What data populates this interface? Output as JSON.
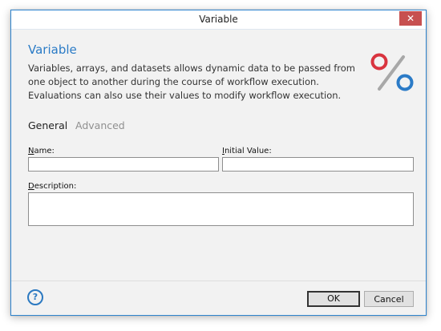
{
  "window": {
    "title": "Variable",
    "close_glyph": "✕"
  },
  "header": {
    "title": "Variable",
    "description": "Variables, arrays, and datasets allows dynamic data to be passed from one object to another during the course of workflow execution. Evaluations can also use their values to modify workflow execution.",
    "logo_icon": "percent-icon",
    "logo_colors": {
      "top_circle": "#d9343f",
      "bottom_circle": "#2b7bc7",
      "slash": "#a8a8a8"
    }
  },
  "tabs": [
    {
      "label": "General",
      "active": true
    },
    {
      "label": "Advanced",
      "active": false
    }
  ],
  "fields": {
    "name": {
      "label": "Name:",
      "access_key": "N",
      "value": ""
    },
    "initial_value": {
      "label": "Initial Value:",
      "access_key": "I",
      "value": ""
    },
    "description": {
      "label": "Description:",
      "access_key": "D",
      "value": ""
    }
  },
  "footer": {
    "help_glyph": "?",
    "ok_label": "OK",
    "cancel_label": "Cancel"
  },
  "colors": {
    "accent": "#2a7bc6",
    "window_border": "#2f85cf",
    "close_button": "#c75050"
  }
}
